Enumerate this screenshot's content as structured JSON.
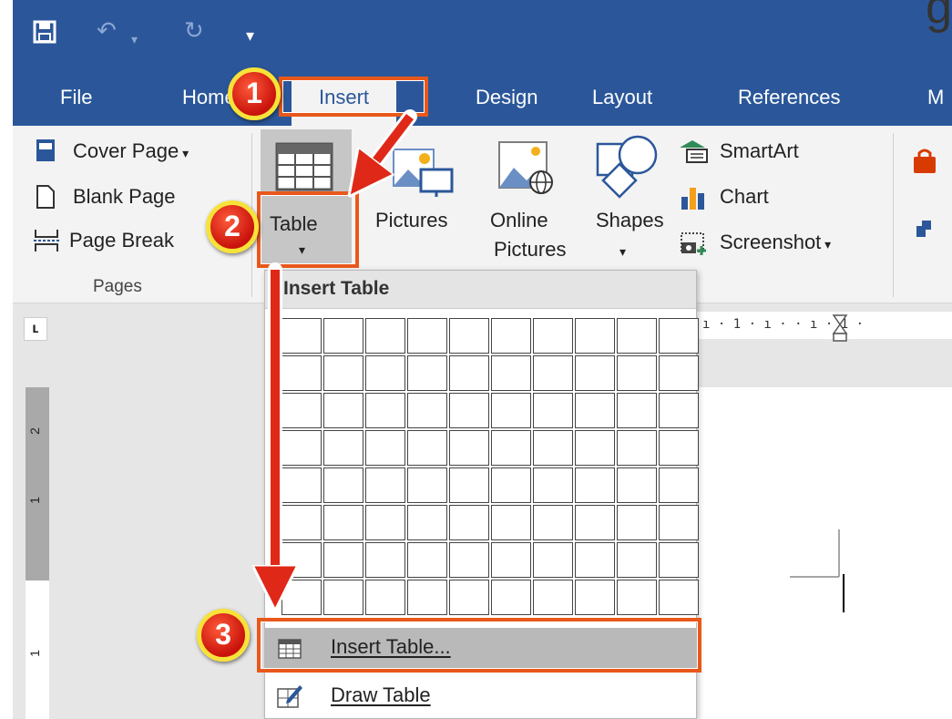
{
  "title_fragment": "g",
  "tabs": [
    "File",
    "Home",
    "Insert",
    "Design",
    "Layout",
    "References",
    "M"
  ],
  "active_tab": "Insert",
  "pages_group": {
    "items": [
      "Cover Page",
      "Blank Page",
      "Page Break"
    ],
    "label": "Pages"
  },
  "table_button": "Table",
  "pictures_button": "Pictures",
  "online_pictures_button": [
    "Online",
    "Pictures"
  ],
  "shapes_button": "Shapes",
  "illustrations_items": [
    "SmartArt",
    "Chart",
    "Screenshot"
  ],
  "dropdown": {
    "header": "Insert Table",
    "grid": {
      "columns": 10,
      "rows": 8
    },
    "insert_table": "Insert Table...",
    "draw_table": "Draw Table"
  },
  "ruler_numbers": {
    "horizontal": "ı · 1 · ı ·  · ı · 1 ·",
    "vertical": [
      "2",
      "1",
      "1"
    ]
  },
  "callouts": [
    "1",
    "2",
    "3"
  ],
  "colors": {
    "accent": "#2b579a",
    "callout_border": "#e8581b",
    "badge": "#d42318",
    "badge_ring": "#f8e23a"
  }
}
